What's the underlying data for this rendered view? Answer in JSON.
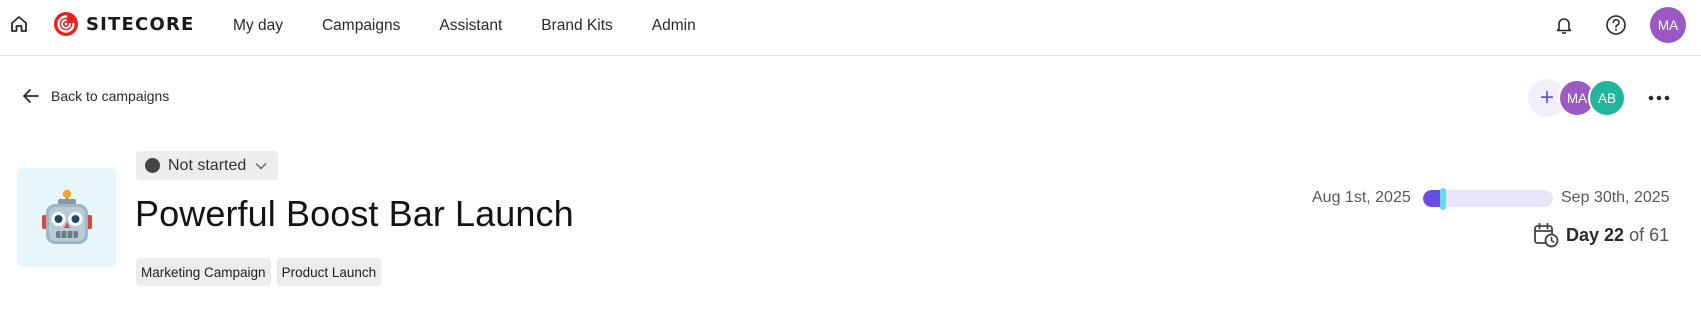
{
  "header": {
    "logo_text": "SITECORE",
    "nav": [
      {
        "label": "My day"
      },
      {
        "label": "Campaigns"
      },
      {
        "label": "Assistant"
      },
      {
        "label": "Brand Kits"
      },
      {
        "label": "Admin"
      }
    ],
    "icons": {
      "home": "home-icon",
      "notifications": "bell-icon",
      "help": "help-circle-icon"
    },
    "user_avatar": "MA"
  },
  "back_link": {
    "label": "Back to campaigns",
    "icon": "arrow-left-icon"
  },
  "collaborators": {
    "add_icon": "+",
    "avatars": [
      {
        "initials": "MA",
        "color": "#9c59c4"
      },
      {
        "initials": "AB",
        "color": "#23b49c"
      }
    ],
    "more_icon": "more-horizontal-icon"
  },
  "campaign": {
    "thumbnail_icon": "robot-icon",
    "status": {
      "label": "Not started",
      "dot_color": "#444444"
    },
    "title": "Powerful Boost Bar Launch",
    "tags": [
      "Marketing Campaign",
      "Product Launch"
    ]
  },
  "timeline": {
    "start_date": "Aug 1st, 2025",
    "end_date": "Sep 30th, 2025",
    "current_day": 22,
    "total_days": 61,
    "day_label": "Day",
    "day_value": "22",
    "of_label": "of 61",
    "progress_fraction": 0.15,
    "colors": {
      "fill": "#6a4de6",
      "track": "#e7e4fb",
      "marker": "#5fe0e0"
    }
  },
  "colors": {
    "accent": "#6a4de6",
    "brand_red": "#eb1f1f"
  }
}
